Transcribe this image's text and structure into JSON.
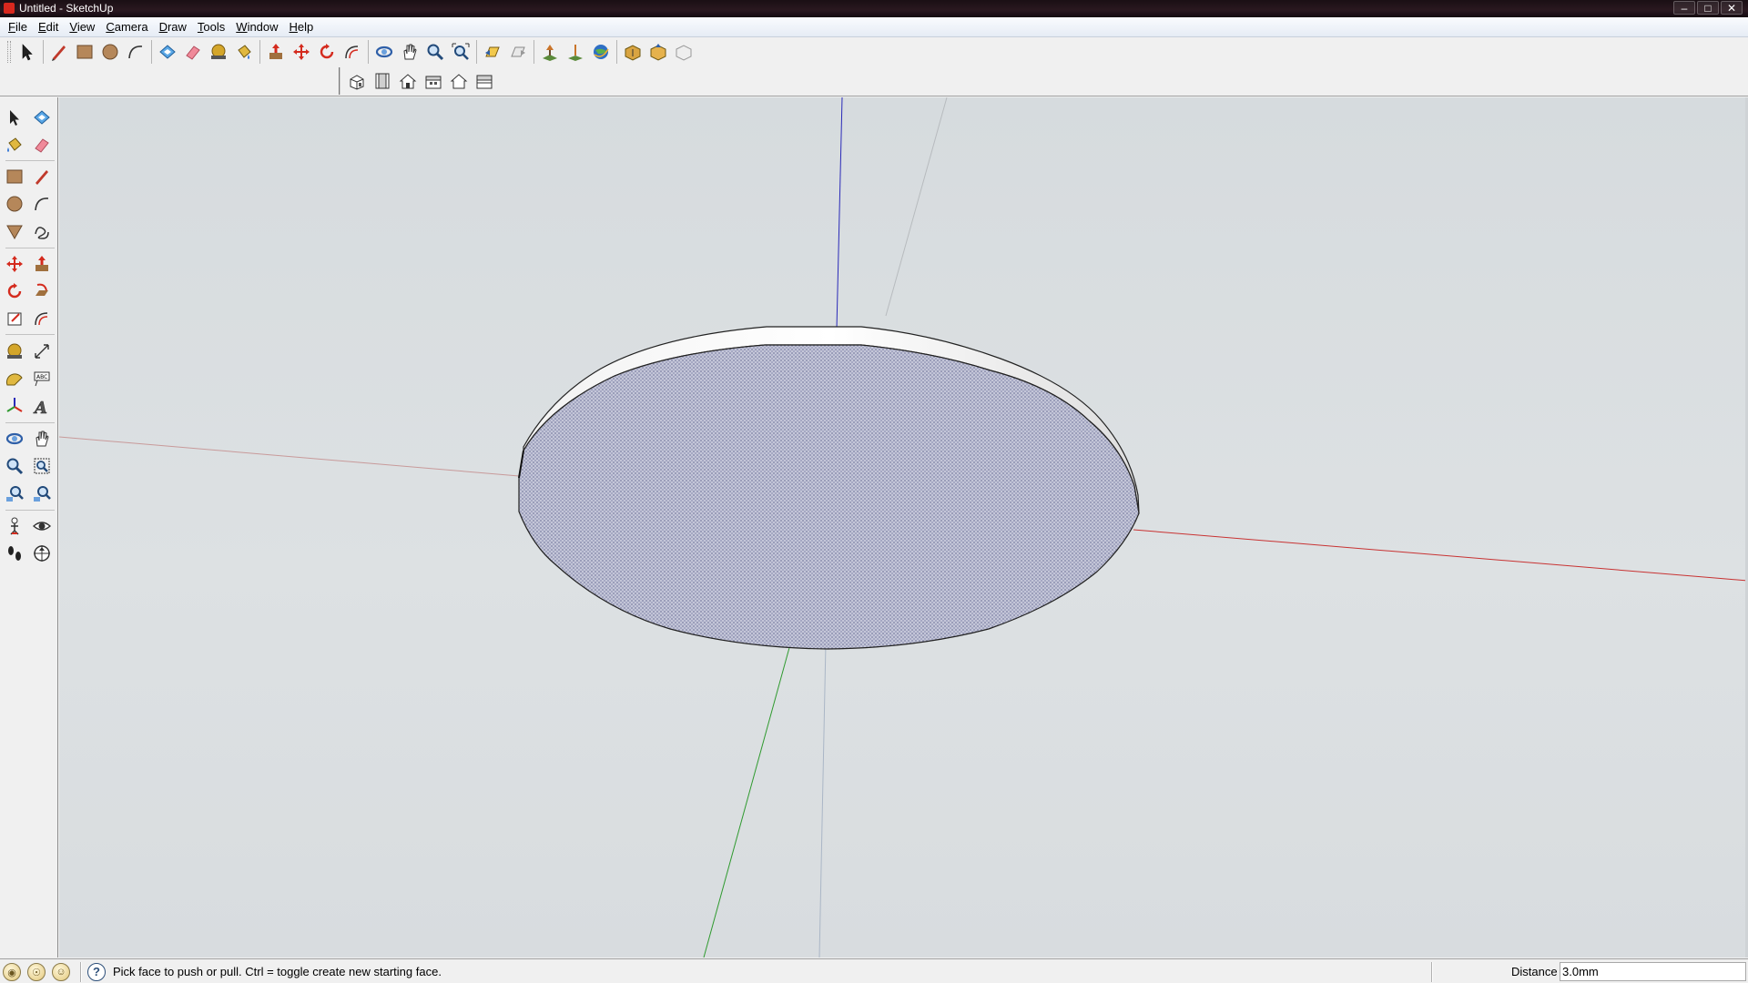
{
  "window": {
    "title": "Untitled - SketchUp",
    "controls": [
      "minimize-icon",
      "maximize-icon",
      "close-icon"
    ]
  },
  "menu": [
    {
      "label": "File",
      "key": "F",
      "rest": "ile"
    },
    {
      "label": "Edit",
      "key": "E",
      "rest": "dit"
    },
    {
      "label": "View",
      "key": "V",
      "rest": "iew"
    },
    {
      "label": "Camera",
      "key": "C",
      "rest": "amera"
    },
    {
      "label": "Draw",
      "key": "D",
      "rest": "raw"
    },
    {
      "label": "Tools",
      "key": "T",
      "rest": "ools"
    },
    {
      "label": "Window",
      "key": "W",
      "rest": "indow"
    },
    {
      "label": "Help",
      "key": "H",
      "rest": "elp"
    }
  ],
  "toolbar_main": [
    "select-icon",
    "pencil-icon",
    "rectangle-icon",
    "circle-icon",
    "arc-icon",
    "make-component-icon",
    "eraser-icon",
    "tape-measure-icon",
    "paint-bucket-icon",
    "push-pull-icon",
    "move-icon",
    "rotate-icon",
    "offset-icon",
    "orbit-icon",
    "pan-icon",
    "zoom-icon",
    "zoom-extents-icon",
    "previous-view-icon",
    "next-view-icon",
    "add-location-icon",
    "toggle-terrain-icon",
    "preview-in-google-earth-icon",
    "get-models-icon",
    "share-model-icon",
    "share-component-icon"
  ],
  "toolbar_views": [
    "iso-view-icon",
    "top-view-icon",
    "front-view-icon",
    "right-view-icon",
    "back-view-icon",
    "left-view-icon"
  ],
  "status": {
    "hint": "Pick face to push or pull.  Ctrl = toggle create new starting face.",
    "measure_label": "Distance",
    "measure_value": "3.0mm"
  },
  "colors": {
    "x_axis": "#c83232",
    "y_axis": "#2f9a2f",
    "z_axis": "#2a2ab8",
    "face_back": "#b7b9cf",
    "face_front": "#ffffff"
  }
}
